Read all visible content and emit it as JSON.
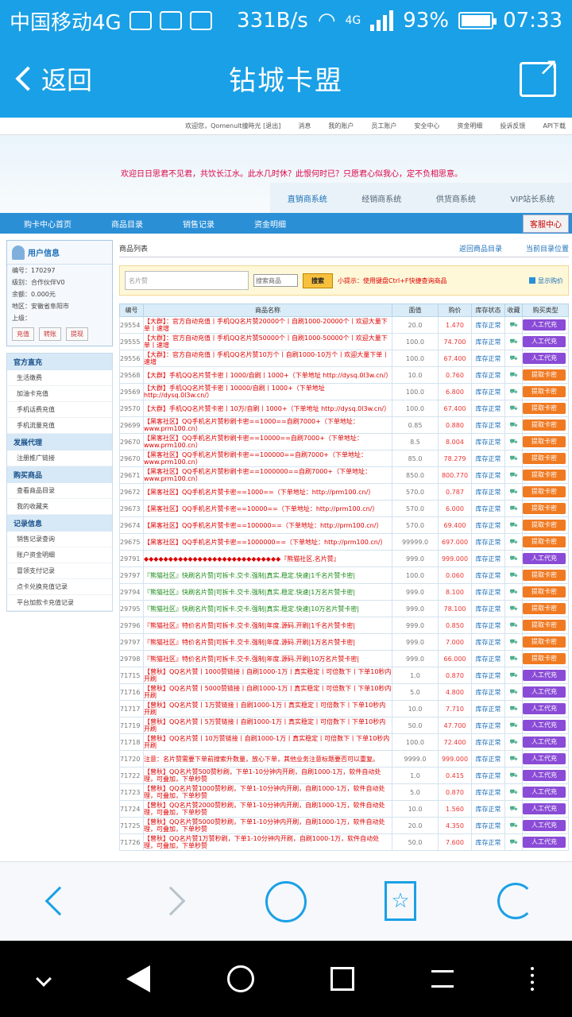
{
  "status": {
    "carrier": "中国移动4G",
    "speed": "331B/s",
    "net": "4G",
    "battery": "93%",
    "time": "07:33"
  },
  "header": {
    "back_label": "返回",
    "title": "钻城卡盟"
  },
  "site": {
    "topnav": [
      "欢迎您，Qomenult撞時光 [退出]",
      "消息",
      "我的账户",
      "员工账户",
      "安全中心",
      "资金明细",
      "投诉反馈",
      "API下载"
    ],
    "marquee": "欢迎日日思君不见君，共饮长江水。此水几时休？此恨何时已？只愿君心似我心，定不负相思意。",
    "systabs": [
      "直销商系统",
      "经销商系统",
      "供货商系统",
      "VIP站长系统"
    ],
    "mainnav": [
      "购卡中心首页",
      "商品目录",
      "销售记录",
      "资金明细"
    ],
    "kefu": "客服中心",
    "user": {
      "title": "用户信息",
      "lines": [
        "编号：170297",
        "级别：合作伙伴V0",
        "余额：0.000元",
        "地区：安徽省阜阳市",
        "上级："
      ],
      "buttons": [
        "充值",
        "转账",
        "提现"
      ]
    },
    "menu": [
      {
        "title": "官方直充",
        "items": [
          "生活缴费",
          "加油卡充值",
          "手机话费充值",
          "手机流量充值"
        ]
      },
      {
        "title": "发展代理",
        "items": [
          "注册推广链接"
        ]
      },
      {
        "title": "购买商品",
        "items": [
          "查看商品目录",
          "我的收藏夹"
        ]
      },
      {
        "title": "记录信息",
        "items": [
          "销售记录查询",
          "账户资金明细",
          "冒领支付记录",
          "点卡兑换充值记录",
          "平台加款卡充值记录"
        ]
      }
    ],
    "list": {
      "title": "商品列表",
      "links": [
        "返回商品目录",
        "当前目录位置"
      ],
      "search_placeholder": "名片赞",
      "select": "搜索商品",
      "search_btn": "搜索",
      "tip": "小提示：使用键盘Ctrl+F快捷查询商品",
      "show_price": "显示购价",
      "headers": [
        "编号",
        "商品名称",
        "面值",
        "购价",
        "库存状态",
        "收藏",
        "购买类型"
      ]
    },
    "rows": [
      [
        "29554",
        "【大群】：官方自动充值丨手机QQ名片赞20000个丨自刷1000-20000个丨欢迎大量下单丨速增",
        "20.0",
        "1.470",
        "库存正常",
        "人工代充",
        "p"
      ],
      [
        "29555",
        "【大群】：官方自动充值丨手机QQ名片赞50000个丨自刷1000-50000个丨欢迎大量下单丨速增",
        "100.0",
        "74.700",
        "库存正常",
        "人工代充",
        "p"
      ],
      [
        "29556",
        "【大群】：官方自动充值丨手机QQ名片赞10万个丨自刷1000-10万个丨欢迎大量下单丨速增",
        "100.0",
        "67.400",
        "库存正常",
        "人工代充",
        "p"
      ],
      [
        "29568",
        "【大群】手机QQ名片赞卡密丨1000/自刷丨1000+（下单地址 http://dysq.0l3w.cn/）",
        "10.0",
        "0.760",
        "库存正常",
        "提取卡密",
        "o"
      ],
      [
        "29569",
        "【大群】手机QQ名片赞卡密丨10000/自刷丨1000+（下单地址 http://dysq.0l3w.cn/）",
        "100.0",
        "6.800",
        "库存正常",
        "提取卡密",
        "o"
      ],
      [
        "29570",
        "【大群】手机QQ名片赞卡密丨10万/自刷丨1000+（下单地址 http://dysq.0l3w.cn/）",
        "100.0",
        "67.400",
        "库存正常",
        "提取卡密",
        "o"
      ],
      [
        "29699",
        "【黑客社区】QQ手机名片赞秒刷卡密==1000==自刷7000+（下单地址：www.prm100.cn）",
        "0.85",
        "0.880",
        "库存正常",
        "提取卡密",
        "o"
      ],
      [
        "29670",
        "【黑客社区】QQ手机名片赞秒刷卡密==10000==自刷7000+（下单地址：www.prm100.cn）",
        "8.5",
        "8.004",
        "库存正常",
        "提取卡密",
        "o"
      ],
      [
        "29670",
        "【黑客社区】QQ手机名片赞秒刷卡密==100000==自刷7000+（下单地址：www.prm100.cn）",
        "85.0",
        "78.279",
        "库存正常",
        "提取卡密",
        "o"
      ],
      [
        "29671",
        "【黑客社区】QQ手机名片赞秒刷卡密==1000000==自刷7000+（下单地址：www.prm100.cn）",
        "850.0",
        "800.770",
        "库存正常",
        "提取卡密",
        "o"
      ],
      [
        "29672",
        "【黑客社区】QQ手机名片赞卡密==1000==（下单地址：http://prm100.cn/）",
        "570.0",
        "0.787",
        "库存正常",
        "提取卡密",
        "o"
      ],
      [
        "29673",
        "【黑客社区】QQ手机名片赞卡密==10000==（下单地址：http://prm100.cn/）",
        "570.0",
        "6.000",
        "库存正常",
        "提取卡密",
        "o"
      ],
      [
        "29674",
        "【黑客社区】QQ手机名片赞卡密==100000==（下单地址：http://prm100.cn/）",
        "570.0",
        "69.400",
        "库存正常",
        "提取卡密",
        "o"
      ],
      [
        "29675",
        "【黑客社区】QQ手机名片赞卡密==1000000==（下单地址：http://prm100.cn/）",
        "99999.0",
        "697.000",
        "库存正常",
        "提取卡密",
        "o"
      ],
      [
        "29791",
        "◆◆◆◆◆◆◆◆◆◆◆◆◆◆◆◆◆◆◆◆◆◆◆◆◆◆◆◆『熊猫社区.名片赞』",
        "999.0",
        "999.000",
        "库存正常",
        "人工代充",
        "p"
      ],
      [
        "29797",
        "『熊猫社区』快刷名片赞|可拆卡.交卡.强制|真实.稳定.快速|1千名片赞卡密|",
        "100.0",
        "0.060",
        "库存正常",
        "提取卡密",
        "o",
        "g"
      ],
      [
        "29794",
        "『熊猫社区』快刷名片赞|可拆卡.交卡.强制|真实.稳定.快速|1万名片赞卡密|",
        "999.0",
        "8.100",
        "库存正常",
        "提取卡密",
        "o",
        "g"
      ],
      [
        "29795",
        "『熊猫社区』快刷名片赞|可拆卡.交卡.强制|真实.稳定.快速|10万名片赞卡密|",
        "999.0",
        "78.100",
        "库存正常",
        "提取卡密",
        "o",
        "g"
      ],
      [
        "29796",
        "『熊猫社区』特价名片赞|可拆卡.交卡.强制|年度.源码.开刷|1千名片赞卡密|",
        "999.0",
        "0.850",
        "库存正常",
        "提取卡密",
        "o"
      ],
      [
        "29797",
        "『熊猫社区』特价名片赞|可拆卡.交卡.强制|年度.源码.开刷|1万名片赞卡密|",
        "999.0",
        "7.000",
        "库存正常",
        "提取卡密",
        "o"
      ],
      [
        "29798",
        "『熊猫社区』特价名片赞|可拆卡.交卡.强制|年度.源码.开刷|10万名片赞卡密|",
        "999.0",
        "66.000",
        "库存正常",
        "提取卡密",
        "o"
      ],
      [
        "71715",
        "【曾秋】QQ名片赞丨1000赞链接丨自刷1000-1万丨真实稳定丨可倍数下丨下单10秒内开刷",
        "1.0",
        "0.870",
        "库存正常",
        "人工代充",
        "p"
      ],
      [
        "71716",
        "【曾秋】QQ名片赞丨5000赞链接丨自刷1000-1万丨真实稳定丨可倍数下丨下单10秒内开刷",
        "5.0",
        "4.800",
        "库存正常",
        "人工代充",
        "p"
      ],
      [
        "71717",
        "【曾秋】QQ名片赞丨1万赞链接丨自刷1000-1万丨真实稳定丨可倍数下丨下单10秒内开刷",
        "10.0",
        "7.710",
        "库存正常",
        "人工代充",
        "p"
      ],
      [
        "71719",
        "【曾秋】QQ名片赞丨5万赞链接丨自刷1000-1万丨真实稳定丨可倍数下丨下单10秒内开刷",
        "50.0",
        "47.700",
        "库存正常",
        "人工代充",
        "p"
      ],
      [
        "71718",
        "【曾秋】QQ名片赞丨10万赞链接丨自刷1000-1万丨真实稳定丨可倍数下丨下单10秒内开刷",
        "100.0",
        "72.400",
        "库存正常",
        "人工代充",
        "p"
      ],
      [
        "71720",
        "注意：名片赞需要下单前搜索升数量，放心下单，其他业务注意标题要否可以重复。",
        "9999.0",
        "999.000",
        "库存正常",
        "人工代充",
        "p"
      ],
      [
        "71722",
        "【曾秋】QQ名片赞500赞秒刷，下单1-10分钟内开刷，自刷1000-1万，软件自动处理，可叠加，下单秒赞",
        "1.0",
        "0.415",
        "库存正常",
        "人工代充",
        "p"
      ],
      [
        "71723",
        "【曾秋】QQ名片赞1000赞秒刷，下单1-10分钟内开刷，自刷1000-1万，软件自动处理，可叠加，下单秒赞",
        "5.0",
        "0.870",
        "库存正常",
        "人工代充",
        "p"
      ],
      [
        "71724",
        "【曾秋】QQ名片赞2000赞秒刷，下单1-10分钟内开刷，自刷1000-1万，软件自动处理，可叠加，下单秒赞",
        "10.0",
        "1.560",
        "库存正常",
        "人工代充",
        "p"
      ],
      [
        "71725",
        "【曾秋】QQ名片赞5000赞秒刷，下单1-10分钟内开刷，自刷1000-1万，软件自动处理，可叠加，下单秒赞",
        "20.0",
        "4.350",
        "库存正常",
        "人工代充",
        "p"
      ],
      [
        "71726",
        "【曾秋】QQ名片赞1万赞秒刷，下单1-10分钟内开刷，自刷1000-1万，软件自动处理，可叠加，下单秒赞",
        "50.0",
        "7.600",
        "库存正常",
        "人工代充",
        "p"
      ]
    ]
  },
  "icons": [
    "back-chevron-icon",
    "share-icon",
    "browser-back-icon",
    "browser-forward-icon",
    "browser-home-icon",
    "bookmark-star-icon",
    "refresh-icon"
  ]
}
